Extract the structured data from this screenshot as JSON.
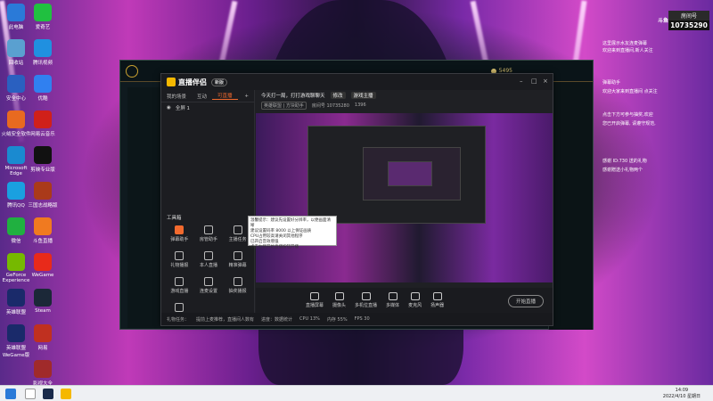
{
  "desktop": {
    "icons": [
      {
        "label": "此电脑",
        "color": "#2a7ad8"
      },
      {
        "label": "回收站",
        "color": "#5aa0d0"
      },
      {
        "label": "安全中心",
        "color": "#2a60c0"
      },
      {
        "label": "火绒安全软件",
        "color": "#e86a20"
      },
      {
        "label": "Microsoft Edge",
        "color": "#1a8ad0"
      },
      {
        "label": "腾讯QQ",
        "color": "#1aa0e0"
      },
      {
        "label": "微信",
        "color": "#20b040"
      },
      {
        "label": "GeForce Experience",
        "color": "#76b900"
      },
      {
        "label": "英雄联盟",
        "color": "#1a2a6a"
      },
      {
        "label": "英雄联盟WeGame版",
        "color": "#1a2a6a"
      },
      {
        "label": "爱奇艺",
        "color": "#20c040"
      },
      {
        "label": "腾讯视频",
        "color": "#2090e0"
      },
      {
        "label": "优酷",
        "color": "#3080f0"
      },
      {
        "label": "网易云音乐",
        "color": "#d0201a"
      },
      {
        "label": "剪映专业版",
        "color": "#111111"
      },
      {
        "label": "三国志战略版",
        "color": "#aa3a1a"
      },
      {
        "label": "斗鱼直播",
        "color": "#f07a20"
      },
      {
        "label": "WeGame",
        "color": "#e82a1a"
      },
      {
        "label": "Steam",
        "color": "#1b2838"
      },
      {
        "label": "网易",
        "color": "#c03020"
      },
      {
        "label": "影视大全",
        "color": "#a02a2a"
      }
    ]
  },
  "game": {
    "currency": "5495"
  },
  "app": {
    "name": "直播伴侣",
    "badge": "新版",
    "tabs": [
      "我的场景",
      "互动",
      "可直播"
    ],
    "scene": "全屏 1",
    "toolbox_label": "工具箱",
    "tools": [
      "弹幕助手",
      "房管助手",
      "主播任务",
      "礼物播报",
      "本人直播",
      "精准弹幕",
      "游戏直播",
      "连麦设置",
      "抽奖播报",
      "礼物投票"
    ],
    "live_title": "今天打一局，打打游戏聊聊天",
    "edit_label": "修改",
    "category": "游戏主播",
    "info": {
      "category_tag": "英雄联盟 | 方块助手",
      "room": "房间号 10735280",
      "online": "1396"
    },
    "bottom_buttons": [
      "直播屏幕",
      "摄像头",
      "多机位直播",
      "多媒体",
      "麦克风",
      "扬声器"
    ],
    "start_label": "开始直播",
    "status": [
      "礼物任务：",
      "提前上麦推荐，直播间人数有",
      "进度：数据统计",
      "CPU 13%",
      "内存 55%",
      "FPS 30"
    ]
  },
  "tooltip_lines": [
    "温馨提示：建议先设置好分辨率，以便画面清晰",
    "建议设置码率 8000 以上保证画质",
    "CPU占用较高请关闭其他程序",
    "已开启音效增强",
    "点击右侧开始直播按钮开播"
  ],
  "overlay": {
    "brand": "斗鱼",
    "room_label": "房间号",
    "room_number": "10735290",
    "chat": [
      "这里展示水友连麦弹幕",
      "欢迎来到直播间,新人关注",
      "弹幕助手",
      "欢迎大家来到直播间 点关注",
      "点击下方可参与抽奖,欢迎",
      "您已开启弹幕, 请遵守规范,",
      "感谢 ID:730 送的礼物",
      "感谢赠送小礼物两个"
    ]
  },
  "taskbar": {
    "time": "14:09",
    "date": "2022/4/10 星期日"
  }
}
